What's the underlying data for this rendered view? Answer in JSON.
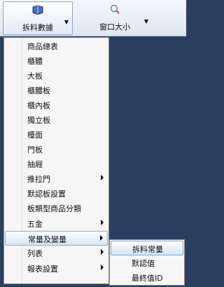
{
  "ribbon": {
    "split_label": "拆料數據",
    "window_label": "窗口大小",
    "split_icon": "book-icon",
    "window_icon": "magnifier-icon"
  },
  "menu": {
    "items": [
      {
        "label": "商品總表",
        "submenu": false
      },
      {
        "label": "櫃體",
        "submenu": false
      },
      {
        "label": "大板",
        "submenu": false
      },
      {
        "label": "櫃體板",
        "submenu": false
      },
      {
        "label": "櫃內板",
        "submenu": false
      },
      {
        "label": "獨立板",
        "submenu": false
      },
      {
        "label": "檯面",
        "submenu": false
      },
      {
        "label": "門板",
        "submenu": false
      },
      {
        "label": "抽屜",
        "submenu": false
      },
      {
        "label": "推拉門",
        "submenu": true
      },
      {
        "label": "默認板設置",
        "submenu": false
      },
      {
        "label": "板類型商品分類",
        "submenu": false
      },
      {
        "label": "五金",
        "submenu": true
      },
      {
        "label": "常量及變量",
        "submenu": true,
        "highlighted": true
      },
      {
        "label": "列表",
        "submenu": true
      },
      {
        "label": "報表設置",
        "submenu": true
      }
    ]
  },
  "submenu": {
    "items": [
      {
        "label": "拆料常量",
        "highlighted": true
      },
      {
        "label": "默認值"
      },
      {
        "label": "最終值ID"
      }
    ]
  },
  "colors": {
    "background": "#2a3e5f",
    "highlight": "#d5e5f8",
    "highlight_border": "#8aa7d0"
  }
}
